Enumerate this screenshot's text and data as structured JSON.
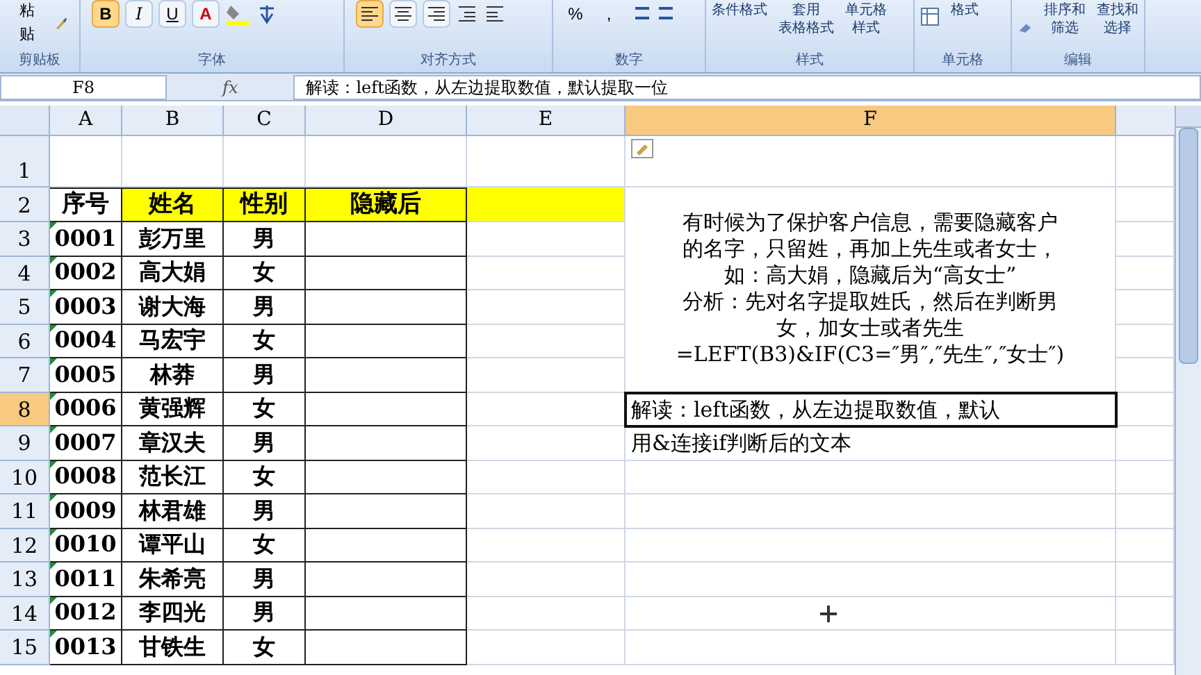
{
  "ribbon": {
    "groups": [
      {
        "label": "剪贴板",
        "kind": "clipboard",
        "buttons": [
          {
            "label": "粘贴",
            "selected": false
          }
        ]
      },
      {
        "label": "字体",
        "kind": "font",
        "buttons": [
          {
            "label": "B",
            "selected": true
          },
          {
            "label": "I",
            "selected": false
          },
          {
            "label": "U",
            "selected": false
          },
          {
            "label": "A",
            "selected": false
          }
        ]
      },
      {
        "label": "对齐方式",
        "kind": "align",
        "buttons": [
          {
            "kind": "left",
            "selected": true
          },
          {
            "kind": "center",
            "selected": false
          },
          {
            "kind": "right",
            "selected": false
          }
        ]
      },
      {
        "label": "数字",
        "kind": "number",
        "buttons": [
          {
            "label": "%"
          },
          {
            "label": ","
          }
        ]
      },
      {
        "label": "样式",
        "kind": "styles",
        "buttons": [
          {
            "lines": [
              "条件格式"
            ]
          },
          {
            "lines": [
              "套用",
              "表格格式"
            ]
          },
          {
            "lines": [
              "单元格",
              "样式"
            ]
          }
        ]
      },
      {
        "label": "单元格",
        "kind": "cells",
        "buttons": [
          {
            "lines": [
              "格式"
            ]
          }
        ]
      },
      {
        "label": "编辑",
        "kind": "editing",
        "buttons": [
          {
            "lines": [
              "排序和",
              "筛选"
            ]
          },
          {
            "lines": [
              "查找和",
              "选择"
            ]
          }
        ]
      }
    ]
  },
  "formula_bar": {
    "name_box": "F8",
    "fx": "fx",
    "formula": "解读：left函数，从左边提取数值，默认提取一位"
  },
  "sheet": {
    "columns": [
      {
        "label": "A",
        "selected": false
      },
      {
        "label": "B",
        "selected": false
      },
      {
        "label": "C",
        "selected": false
      },
      {
        "label": "D",
        "selected": false
      },
      {
        "label": "E",
        "selected": false
      },
      {
        "label": "F",
        "selected": true
      }
    ],
    "row_numbers": [
      {
        "label": "1",
        "selected": false
      },
      {
        "label": "2",
        "selected": false
      },
      {
        "label": "3",
        "selected": false
      },
      {
        "label": "4",
        "selected": false
      },
      {
        "label": "5",
        "selected": false
      },
      {
        "label": "6",
        "selected": false
      },
      {
        "label": "7",
        "selected": false
      },
      {
        "label": "8",
        "selected": true
      },
      {
        "label": "9",
        "selected": false
      },
      {
        "label": "10",
        "selected": false
      },
      {
        "label": "11",
        "selected": false
      },
      {
        "label": "12",
        "selected": false
      },
      {
        "label": "13",
        "selected": false
      },
      {
        "label": "14",
        "selected": false
      },
      {
        "label": "15",
        "selected": false
      }
    ],
    "header": {
      "cells": [
        {
          "text": "序号",
          "highlighted": false
        },
        {
          "text": "姓名",
          "highlighted": true
        },
        {
          "text": "性别",
          "highlighted": true
        },
        {
          "text": "隐藏后",
          "highlighted": true
        }
      ],
      "band_highlighted": true
    },
    "rows": [
      [
        "0001",
        "彭万里",
        "男"
      ],
      [
        "0002",
        "高大娟",
        "女"
      ],
      [
        "0003",
        "谢大海",
        "男"
      ],
      [
        "0004",
        "马宏宇",
        "女"
      ],
      [
        "0005",
        "林莽",
        "男"
      ],
      [
        "0006",
        "黄强辉",
        "女"
      ],
      [
        "0007",
        "章汉夫",
        "男"
      ],
      [
        "0008",
        "范长江",
        "女"
      ],
      [
        "0009",
        "林君雄",
        "男"
      ],
      [
        "0010",
        "谭平山",
        "女"
      ],
      [
        "0011",
        "朱希亮",
        "男"
      ],
      [
        "0012",
        "李四光",
        "男"
      ],
      [
        "0013",
        "甘铁生",
        "女"
      ]
    ],
    "note": {
      "lines": [
        "有时候为了保护客户信息，需要隐藏客户",
        "的名字，只留姓，再加上先生或者女士，",
        "如：高大娟，隐藏后为“高女士”",
        "分析：先对名字提取姓氏，然后在判断男",
        "女，加女士或者先生",
        "=LEFT(B3)&IF(C3=″男″,″先生″,″女士″)"
      ]
    },
    "active_cell": {
      "text": "解读：left函数，从左边提取数值，默认",
      "selected": true
    },
    "next_cell": {
      "text": "用&连接if判断后的文本"
    }
  }
}
